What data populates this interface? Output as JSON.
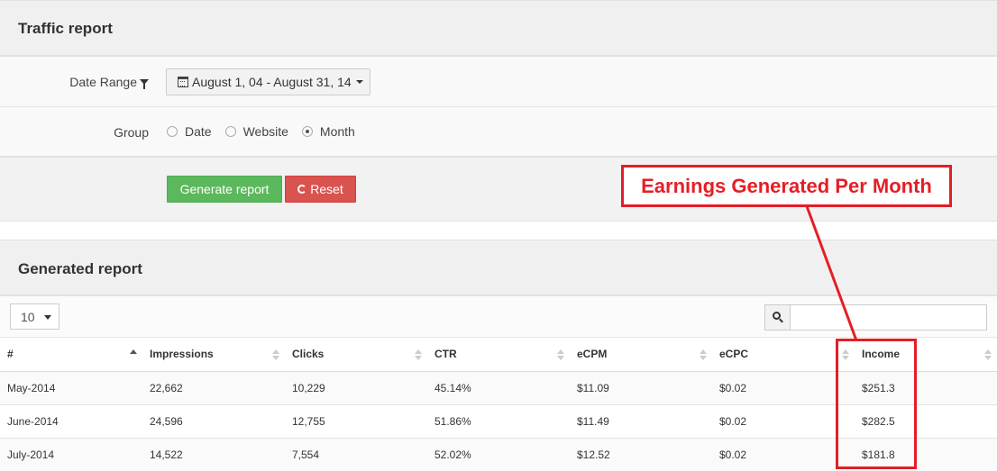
{
  "traffic_panel": {
    "title": "Traffic report"
  },
  "date_range": {
    "label": "Date Range",
    "value": "August 1, 04 - August 31, 14"
  },
  "group": {
    "label": "Group",
    "options": [
      "Date",
      "Website",
      "Month"
    ],
    "selected": "Month"
  },
  "buttons": {
    "generate": "Generate report",
    "reset": "Reset"
  },
  "generated_panel": {
    "title": "Generated report"
  },
  "table": {
    "page_size": "10",
    "search_placeholder": "",
    "headers": [
      "#",
      "Impressions",
      "Clicks",
      "CTR",
      "eCPM",
      "eCPC",
      "Income"
    ],
    "rows": [
      [
        "May-2014",
        "22,662",
        "10,229",
        "45.14%",
        "$11.09",
        "$0.02",
        "$251.3"
      ],
      [
        "June-2014",
        "24,596",
        "12,755",
        "51.86%",
        "$11.49",
        "$0.02",
        "$282.5"
      ],
      [
        "July-2014",
        "14,522",
        "7,554",
        "52.02%",
        "$12.52",
        "$0.02",
        "$181.8"
      ]
    ]
  },
  "annotation": {
    "text": "Earnings Generated Per Month",
    "color": "#e41e26"
  },
  "colors": {
    "success": "#5cb85c",
    "danger": "#d9534f"
  }
}
